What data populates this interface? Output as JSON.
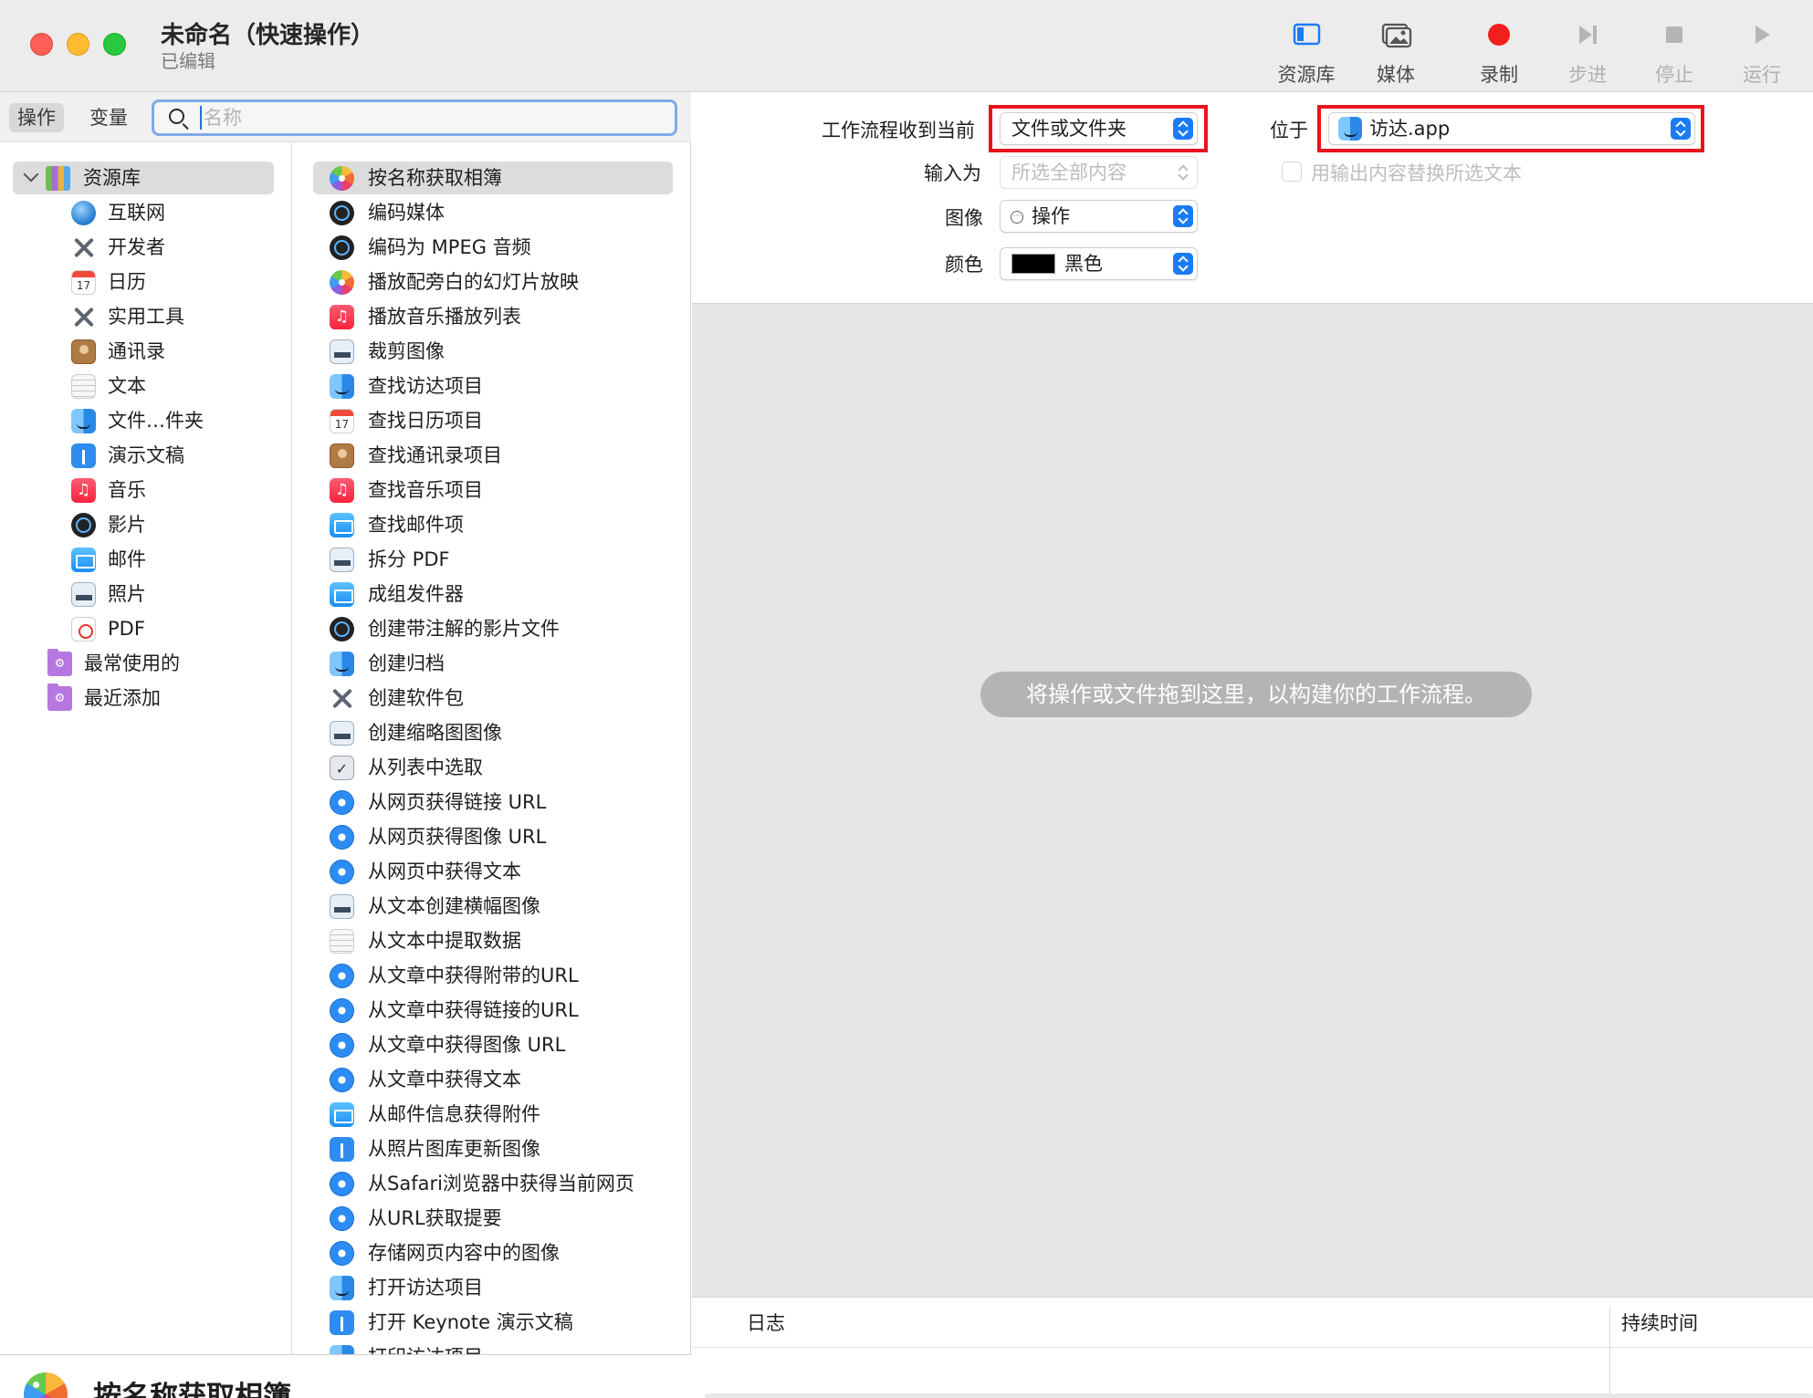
{
  "window": {
    "title": "未命名（快速操作）",
    "subtitle": "已编辑"
  },
  "toolbar": {
    "buttons": [
      {
        "label": "资源库",
        "icon": "sidebar-icon",
        "enabled": true
      },
      {
        "label": "媒体",
        "icon": "media-icon",
        "enabled": true
      },
      {
        "label": "录制",
        "icon": "record-icon",
        "enabled": true
      },
      {
        "label": "步进",
        "icon": "step-icon",
        "enabled": false
      },
      {
        "label": "停止",
        "icon": "stop-icon",
        "enabled": false
      },
      {
        "label": "运行",
        "icon": "run-icon",
        "enabled": false
      }
    ]
  },
  "left": {
    "tabs": [
      "操作",
      "变量"
    ],
    "active_tab": "操作",
    "search": {
      "placeholder": "名称",
      "value": ""
    }
  },
  "library": {
    "root": "资源库",
    "items": [
      {
        "label": "互联网",
        "icon": "globe-icon"
      },
      {
        "label": "开发者",
        "icon": "tools-icon"
      },
      {
        "label": "日历",
        "icon": "calendar-icon"
      },
      {
        "label": "实用工具",
        "icon": "tools-icon"
      },
      {
        "label": "通讯录",
        "icon": "contacts-icon"
      },
      {
        "label": "文本",
        "icon": "text-icon"
      },
      {
        "label": "文件…件夹",
        "icon": "finder-icon"
      },
      {
        "label": "演示文稿",
        "icon": "keynote-icon"
      },
      {
        "label": "音乐",
        "icon": "music-icon"
      },
      {
        "label": "影片",
        "icon": "movie-icon"
      },
      {
        "label": "邮件",
        "icon": "mail-icon"
      },
      {
        "label": "照片",
        "icon": "photo-doc-icon"
      },
      {
        "label": "PDF",
        "icon": "pdf-icon"
      }
    ],
    "groups": [
      {
        "label": "最常使用的",
        "icon": "smart-folder-icon"
      },
      {
        "label": "最近添加",
        "icon": "smart-folder-icon"
      }
    ]
  },
  "actions": [
    {
      "label": "按名称获取相簿",
      "icon": "photos-icon"
    },
    {
      "label": "编码媒体",
      "icon": "movie-icon"
    },
    {
      "label": "编码为 MPEG 音频",
      "icon": "movie-icon"
    },
    {
      "label": "播放配旁白的幻灯片放映",
      "icon": "photos-icon"
    },
    {
      "label": "播放音乐播放列表",
      "icon": "music-icon"
    },
    {
      "label": "裁剪图像",
      "icon": "photo-doc-icon"
    },
    {
      "label": "查找访达项目",
      "icon": "finder-icon"
    },
    {
      "label": "查找日历项目",
      "icon": "calendar-icon"
    },
    {
      "label": "查找通讯录项目",
      "icon": "contacts-icon"
    },
    {
      "label": "查找音乐项目",
      "icon": "music-icon"
    },
    {
      "label": "查找邮件项",
      "icon": "mail-icon"
    },
    {
      "label": "拆分 PDF",
      "icon": "photo-doc-icon"
    },
    {
      "label": "成组发件器",
      "icon": "mail-icon"
    },
    {
      "label": "创建带注解的影片文件",
      "icon": "movie-icon"
    },
    {
      "label": "创建归档",
      "icon": "finder-icon"
    },
    {
      "label": "创建软件包",
      "icon": "tools-icon"
    },
    {
      "label": "创建缩略图图像",
      "icon": "photo-doc-icon"
    },
    {
      "label": "从列表中选取",
      "icon": "choose-icon"
    },
    {
      "label": "从网页获得链接 URL",
      "icon": "safari-icon"
    },
    {
      "label": "从网页获得图像 URL",
      "icon": "safari-icon"
    },
    {
      "label": "从网页中获得文本",
      "icon": "safari-icon"
    },
    {
      "label": "从文本创建横幅图像",
      "icon": "photo-doc-icon"
    },
    {
      "label": "从文本中提取数据",
      "icon": "text-icon"
    },
    {
      "label": "从文章中获得附带的URL",
      "icon": "safari-icon"
    },
    {
      "label": "从文章中获得链接的URL",
      "icon": "safari-icon"
    },
    {
      "label": "从文章中获得图像 URL",
      "icon": "safari-icon"
    },
    {
      "label": "从文章中获得文本",
      "icon": "safari-icon"
    },
    {
      "label": "从邮件信息获得附件",
      "icon": "mail-icon"
    },
    {
      "label": "从照片图库更新图像",
      "icon": "keynote-icon"
    },
    {
      "label": "从Safari浏览器中获得当前网页",
      "icon": "safari-icon"
    },
    {
      "label": "从URL获取提要",
      "icon": "safari-icon"
    },
    {
      "label": "存储网页内容中的图像",
      "icon": "safari-icon"
    },
    {
      "label": "打开访达项目",
      "icon": "finder-icon"
    },
    {
      "label": "打开 Keynote 演示文稿",
      "icon": "keynote-icon"
    },
    {
      "label": "打印访达项目",
      "icon": "finder-icon"
    }
  ],
  "selected_action": "按名称获取相簿",
  "workflow_config": {
    "receives_label": "工作流程收到当前",
    "receives_value": "文件或文件夹",
    "in_label": "位于",
    "in_value": "访达.app",
    "input_label": "输入为",
    "input_value": "所选全部内容",
    "replace_label": "用输出内容替换所选文本",
    "image_label": "图像",
    "image_value": "操作",
    "color_label": "颜色",
    "color_value": "黑色",
    "color_swatch": "#000000"
  },
  "canvas": {
    "hint": "将操作或文件拖到这里，以构建你的工作流程。"
  },
  "log": {
    "col_log": "日志",
    "col_duration": "持续时间"
  }
}
